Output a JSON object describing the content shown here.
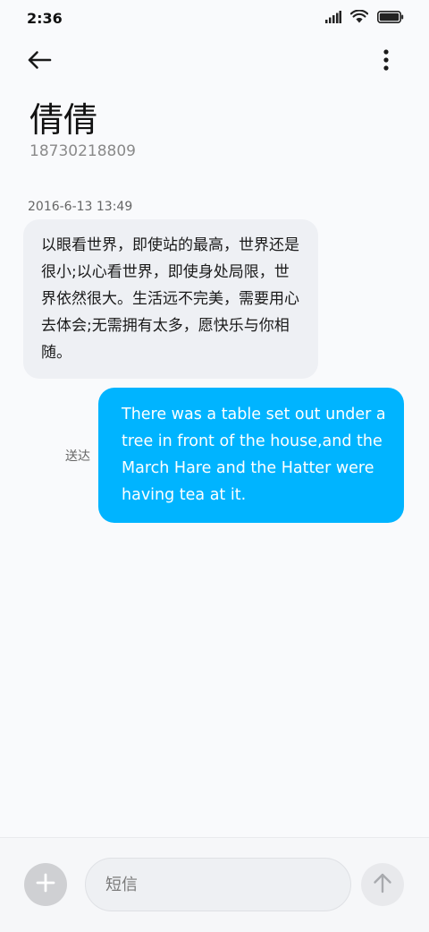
{
  "status_bar": {
    "time": "2:36",
    "icons": [
      "signal-icon",
      "wifi-icon",
      "battery-icon"
    ]
  },
  "header": {
    "back_icon": "arrow-left-icon",
    "more_icon": "more-vertical-icon",
    "contact_name": "倩倩",
    "contact_number": "18730218809"
  },
  "conversation": {
    "timestamp": "2016-6-13 13:49",
    "incoming_message": "以眼看世界，即使站的最高，世界还是很小;以心看世界，即使身处局限，世界依然很大。生活远不完美，需要用心去体会;无需拥有太多，愿快乐与你相随。",
    "outgoing_message": "There was a table set out under a tree in front of the house,and the March Hare and the Hatter were having tea at it.",
    "outgoing_status": "送达"
  },
  "composer": {
    "add_icon": "plus-icon",
    "placeholder": "短信",
    "send_icon": "arrow-up-icon"
  },
  "colors": {
    "outgoing_bubble": "#00b4ff",
    "incoming_bubble": "#eef0f4",
    "background": "#f9fafc"
  }
}
